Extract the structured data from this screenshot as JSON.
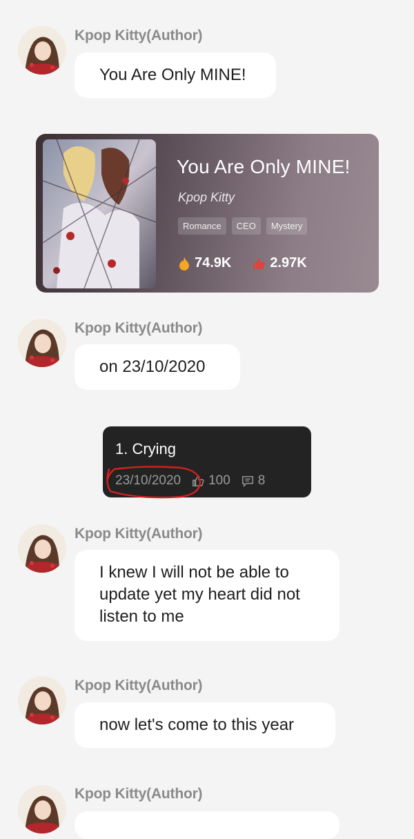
{
  "messages": [
    {
      "author": "Kpop Kitty(Author)",
      "text": "You Are Only MINE!"
    },
    {
      "author": "Kpop Kitty(Author)",
      "text": "on 23/10/2020"
    },
    {
      "author": "Kpop Kitty(Author)",
      "text": "I knew I will not be able to update yet my heart did not listen to me"
    },
    {
      "author": "Kpop Kitty(Author)",
      "text": "now let's come to this year"
    },
    {
      "author": "Kpop Kitty(Author)",
      "text": ""
    }
  ],
  "book": {
    "title": "You Are Only MINE!",
    "author": "Kpop Kitty",
    "tags": [
      "Romance",
      "CEO",
      "Mystery"
    ],
    "views": "74.9K",
    "likes": "2.97K",
    "icons": {
      "views": "flame-icon",
      "likes": "thumbs-up-icon"
    }
  },
  "chapter": {
    "title": "1. Crying",
    "date": "23/10/2020",
    "likes": "100",
    "comments": "8",
    "icons": {
      "likes": "thumbs-up-outline-icon",
      "comments": "comment-icon"
    }
  },
  "colors": {
    "background": "#f4f4f4",
    "bubble": "#ffffff",
    "author_name": "#8a8a8a",
    "flame": "#f5a623",
    "like": "#e0433a",
    "chapter_card": "#232323",
    "annotation_circle": "#d6201f"
  }
}
